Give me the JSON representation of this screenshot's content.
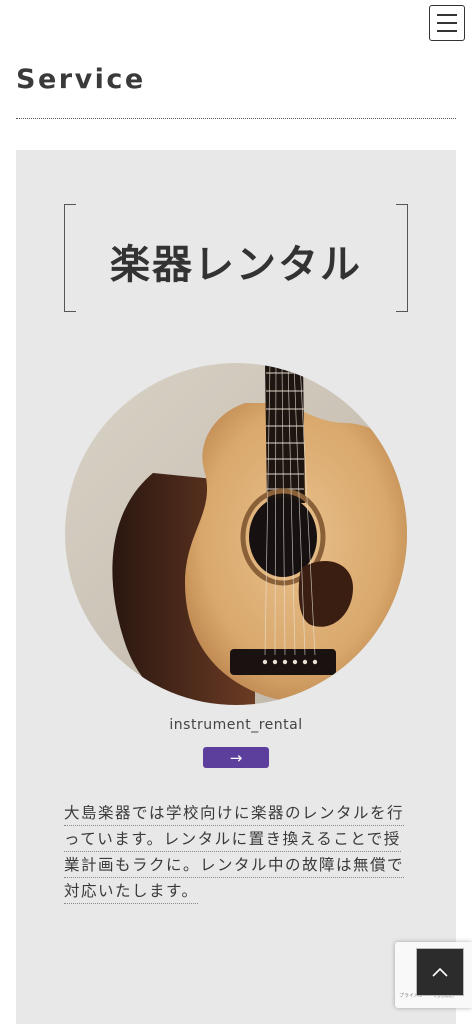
{
  "header": {
    "menu_icon": "hamburger-menu-icon"
  },
  "section": {
    "title": "Service"
  },
  "card": {
    "heading": "楽器レンタル",
    "image_alt": "acoustic guitar",
    "caption": "instrument_rental",
    "arrow": "→",
    "description_lines": [
      "大島楽器では学校向けに楽器のレンタルを行",
      "っています。レンタルに置き換えることで授",
      "業計画もラクに。レンタル中の故障は無償で",
      "対応いたします。"
    ]
  },
  "recaptcha": {
    "text": "プライバシー・利用規約"
  },
  "back_to_top": {
    "icon": "chevron-up-icon"
  },
  "colors": {
    "card_background": "#e8e8e8",
    "accent": "#5c3f9c",
    "text": "#3a3a3a"
  }
}
